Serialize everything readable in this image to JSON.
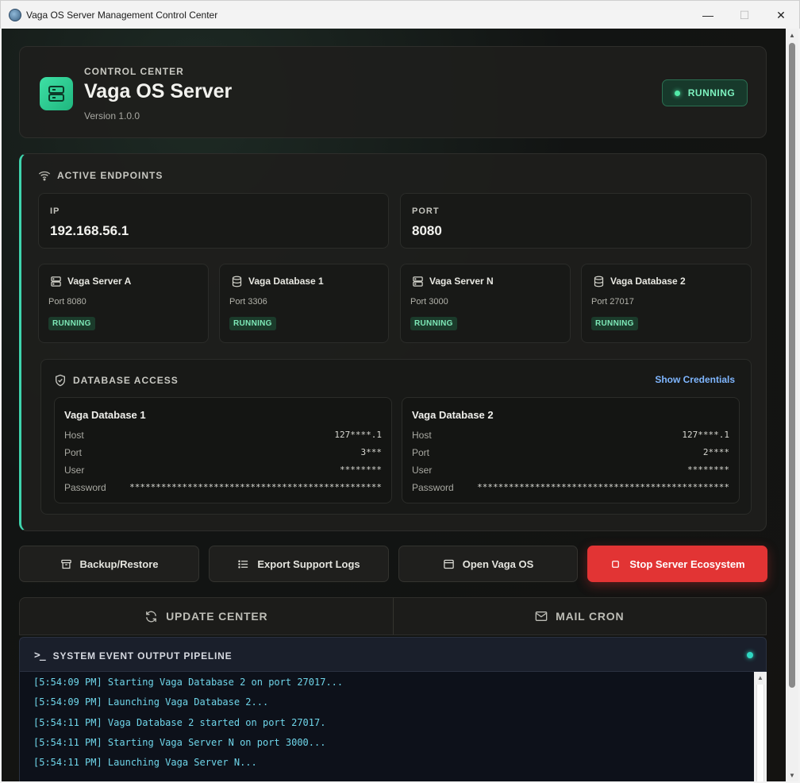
{
  "window": {
    "title": "Vaga OS Server Management Control Center",
    "minimize": "—",
    "maximize": "☐",
    "close": "✕"
  },
  "header": {
    "overline": "CONTROL CENTER",
    "app_name": "Vaga OS Server",
    "version": "Version 1.0.0",
    "status": "RUNNING",
    "accent": "#2fd494"
  },
  "endpoints": {
    "title": "ACTIVE ENDPOINTS",
    "ip_label": "IP",
    "ip_value": "192.168.56.1",
    "port_label": "PORT",
    "port_value": "8080",
    "services": [
      {
        "name": "Vaga Server A",
        "port": "Port 8080",
        "status": "RUNNING",
        "icon": "server-icon"
      },
      {
        "name": "Vaga Database 1",
        "port": "Port 3306",
        "status": "RUNNING",
        "icon": "database-icon"
      },
      {
        "name": "Vaga Server N",
        "port": "Port 3000",
        "status": "RUNNING",
        "icon": "server-icon"
      },
      {
        "name": "Vaga Database 2",
        "port": "Port 27017",
        "status": "RUNNING",
        "icon": "database-icon"
      }
    ]
  },
  "db_access": {
    "title": "DATABASE ACCESS",
    "show_credentials": "Show Credentials",
    "databases": [
      {
        "name": "Vaga Database 1",
        "rows": [
          {
            "label": "Host",
            "value": "127****.1"
          },
          {
            "label": "Port",
            "value": "3***"
          },
          {
            "label": "User",
            "value": "********"
          },
          {
            "label": "Password",
            "value": "************************************************"
          }
        ]
      },
      {
        "name": "Vaga Database 2",
        "rows": [
          {
            "label": "Host",
            "value": "127****.1"
          },
          {
            "label": "Port",
            "value": "2****"
          },
          {
            "label": "User",
            "value": "********"
          },
          {
            "label": "Password",
            "value": "************************************************"
          }
        ]
      }
    ]
  },
  "actions": {
    "backup": "Backup/Restore",
    "export_logs": "Export Support Logs",
    "open_os": "Open Vaga OS",
    "stop": "Stop Server Ecosystem",
    "danger_color": "#e23434"
  },
  "tabs": [
    {
      "label": "UPDATE CENTER",
      "icon": "refresh-icon"
    },
    {
      "label": "MAIL CRON",
      "icon": "mail-icon"
    }
  ],
  "console": {
    "title": "SYSTEM EVENT OUTPUT PIPELINE",
    "prompt": ">_",
    "lines": [
      "[5:54:09 PM] Starting Vaga Database 2 on port 27017...",
      "[5:54:09 PM] Launching Vaga Database 2...",
      "[5:54:11 PM] Vaga Database 2 started on port 27017.",
      "[5:54:11 PM] Starting Vaga Server N on port 3000...",
      "[5:54:11 PM] Launching Vaga Server N..."
    ]
  }
}
